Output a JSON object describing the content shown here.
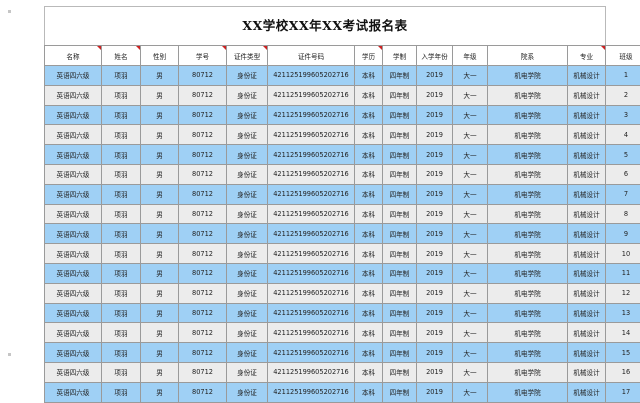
{
  "sheet": {
    "title": "XX学校XX年XX考试报名表",
    "headers": [
      "名称",
      "姓名",
      "性别",
      "学号",
      "证件类型",
      "证件号码",
      "学历",
      "学制",
      "入学年份",
      "年级",
      "院系",
      "专业",
      "班级"
    ],
    "header_marked": [
      true,
      true,
      false,
      true,
      true,
      false,
      true,
      false,
      false,
      false,
      false,
      true,
      false
    ],
    "row_colors": [
      "#9fd0f5",
      "#ececec"
    ],
    "rows": [
      [
        "英语四六级",
        "项羽",
        "男",
        "80712",
        "身份证",
        "421125199605202716",
        "本科",
        "四年制",
        "2019",
        "大一",
        "机电学院",
        "机械设计",
        "1"
      ],
      [
        "英语四六级",
        "项羽",
        "男",
        "80712",
        "身份证",
        "421125199605202716",
        "本科",
        "四年制",
        "2019",
        "大一",
        "机电学院",
        "机械设计",
        "2"
      ],
      [
        "英语四六级",
        "项羽",
        "男",
        "80712",
        "身份证",
        "421125199605202716",
        "本科",
        "四年制",
        "2019",
        "大一",
        "机电学院",
        "机械设计",
        "3"
      ],
      [
        "英语四六级",
        "项羽",
        "男",
        "80712",
        "身份证",
        "421125199605202716",
        "本科",
        "四年制",
        "2019",
        "大一",
        "机电学院",
        "机械设计",
        "4"
      ],
      [
        "英语四六级",
        "项羽",
        "男",
        "80712",
        "身份证",
        "421125199605202716",
        "本科",
        "四年制",
        "2019",
        "大一",
        "机电学院",
        "机械设计",
        "5"
      ],
      [
        "英语四六级",
        "项羽",
        "男",
        "80712",
        "身份证",
        "421125199605202716",
        "本科",
        "四年制",
        "2019",
        "大一",
        "机电学院",
        "机械设计",
        "6"
      ],
      [
        "英语四六级",
        "项羽",
        "男",
        "80712",
        "身份证",
        "421125199605202716",
        "本科",
        "四年制",
        "2019",
        "大一",
        "机电学院",
        "机械设计",
        "7"
      ],
      [
        "英语四六级",
        "项羽",
        "男",
        "80712",
        "身份证",
        "421125199605202716",
        "本科",
        "四年制",
        "2019",
        "大一",
        "机电学院",
        "机械设计",
        "8"
      ],
      [
        "英语四六级",
        "项羽",
        "男",
        "80712",
        "身份证",
        "421125199605202716",
        "本科",
        "四年制",
        "2019",
        "大一",
        "机电学院",
        "机械设计",
        "9"
      ],
      [
        "英语四六级",
        "项羽",
        "男",
        "80712",
        "身份证",
        "421125199605202716",
        "本科",
        "四年制",
        "2019",
        "大一",
        "机电学院",
        "机械设计",
        "10"
      ],
      [
        "英语四六级",
        "项羽",
        "男",
        "80712",
        "身份证",
        "421125199605202716",
        "本科",
        "四年制",
        "2019",
        "大一",
        "机电学院",
        "机械设计",
        "11"
      ],
      [
        "英语四六级",
        "项羽",
        "男",
        "80712",
        "身份证",
        "421125199605202716",
        "本科",
        "四年制",
        "2019",
        "大一",
        "机电学院",
        "机械设计",
        "12"
      ],
      [
        "英语四六级",
        "项羽",
        "男",
        "80712",
        "身份证",
        "421125199605202716",
        "本科",
        "四年制",
        "2019",
        "大一",
        "机电学院",
        "机械设计",
        "13"
      ],
      [
        "英语四六级",
        "项羽",
        "男",
        "80712",
        "身份证",
        "421125199605202716",
        "本科",
        "四年制",
        "2019",
        "大一",
        "机电学院",
        "机械设计",
        "14"
      ],
      [
        "英语四六级",
        "项羽",
        "男",
        "80712",
        "身份证",
        "421125199605202716",
        "本科",
        "四年制",
        "2019",
        "大一",
        "机电学院",
        "机械设计",
        "15"
      ],
      [
        "英语四六级",
        "项羽",
        "男",
        "80712",
        "身份证",
        "421125199605202716",
        "本科",
        "四年制",
        "2019",
        "大一",
        "机电学院",
        "机械设计",
        "16"
      ],
      [
        "英语四六级",
        "项羽",
        "男",
        "80712",
        "身份证",
        "421125199605202716",
        "本科",
        "四年制",
        "2019",
        "大一",
        "机电学院",
        "机械设计",
        "17"
      ]
    ]
  }
}
